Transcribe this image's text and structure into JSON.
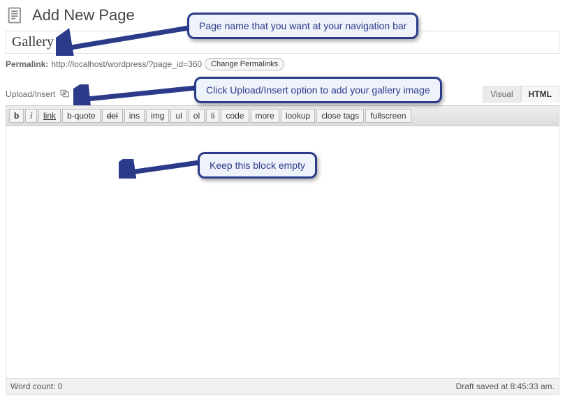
{
  "header": {
    "title": "Add New Page"
  },
  "title_input": {
    "value": "Gallery"
  },
  "permalink": {
    "label": "Permalink:",
    "url": "http://localhost/wordpress/?page_id=360",
    "change_label": "Change Permalinks"
  },
  "upload": {
    "label": "Upload/Insert"
  },
  "tabs": {
    "visual": "Visual",
    "html": "HTML"
  },
  "toolbar": {
    "b": "b",
    "i": "i",
    "link": "link",
    "bquote": "b-quote",
    "del": "del",
    "ins": "ins",
    "img": "img",
    "ul": "ul",
    "ol": "ol",
    "li": "li",
    "code": "code",
    "more": "more",
    "lookup": "lookup",
    "closetags": "close tags",
    "fullscreen": "fullscreen"
  },
  "status": {
    "wordcount_label": "Word count: ",
    "wordcount_value": "0",
    "draft_saved": "Draft saved at 8:45:33 am."
  },
  "callouts": {
    "c1": "Page name that you want at your navigation bar",
    "c2": "Click Upload/Insert option to add your gallery image",
    "c3": "Keep this block empty"
  }
}
